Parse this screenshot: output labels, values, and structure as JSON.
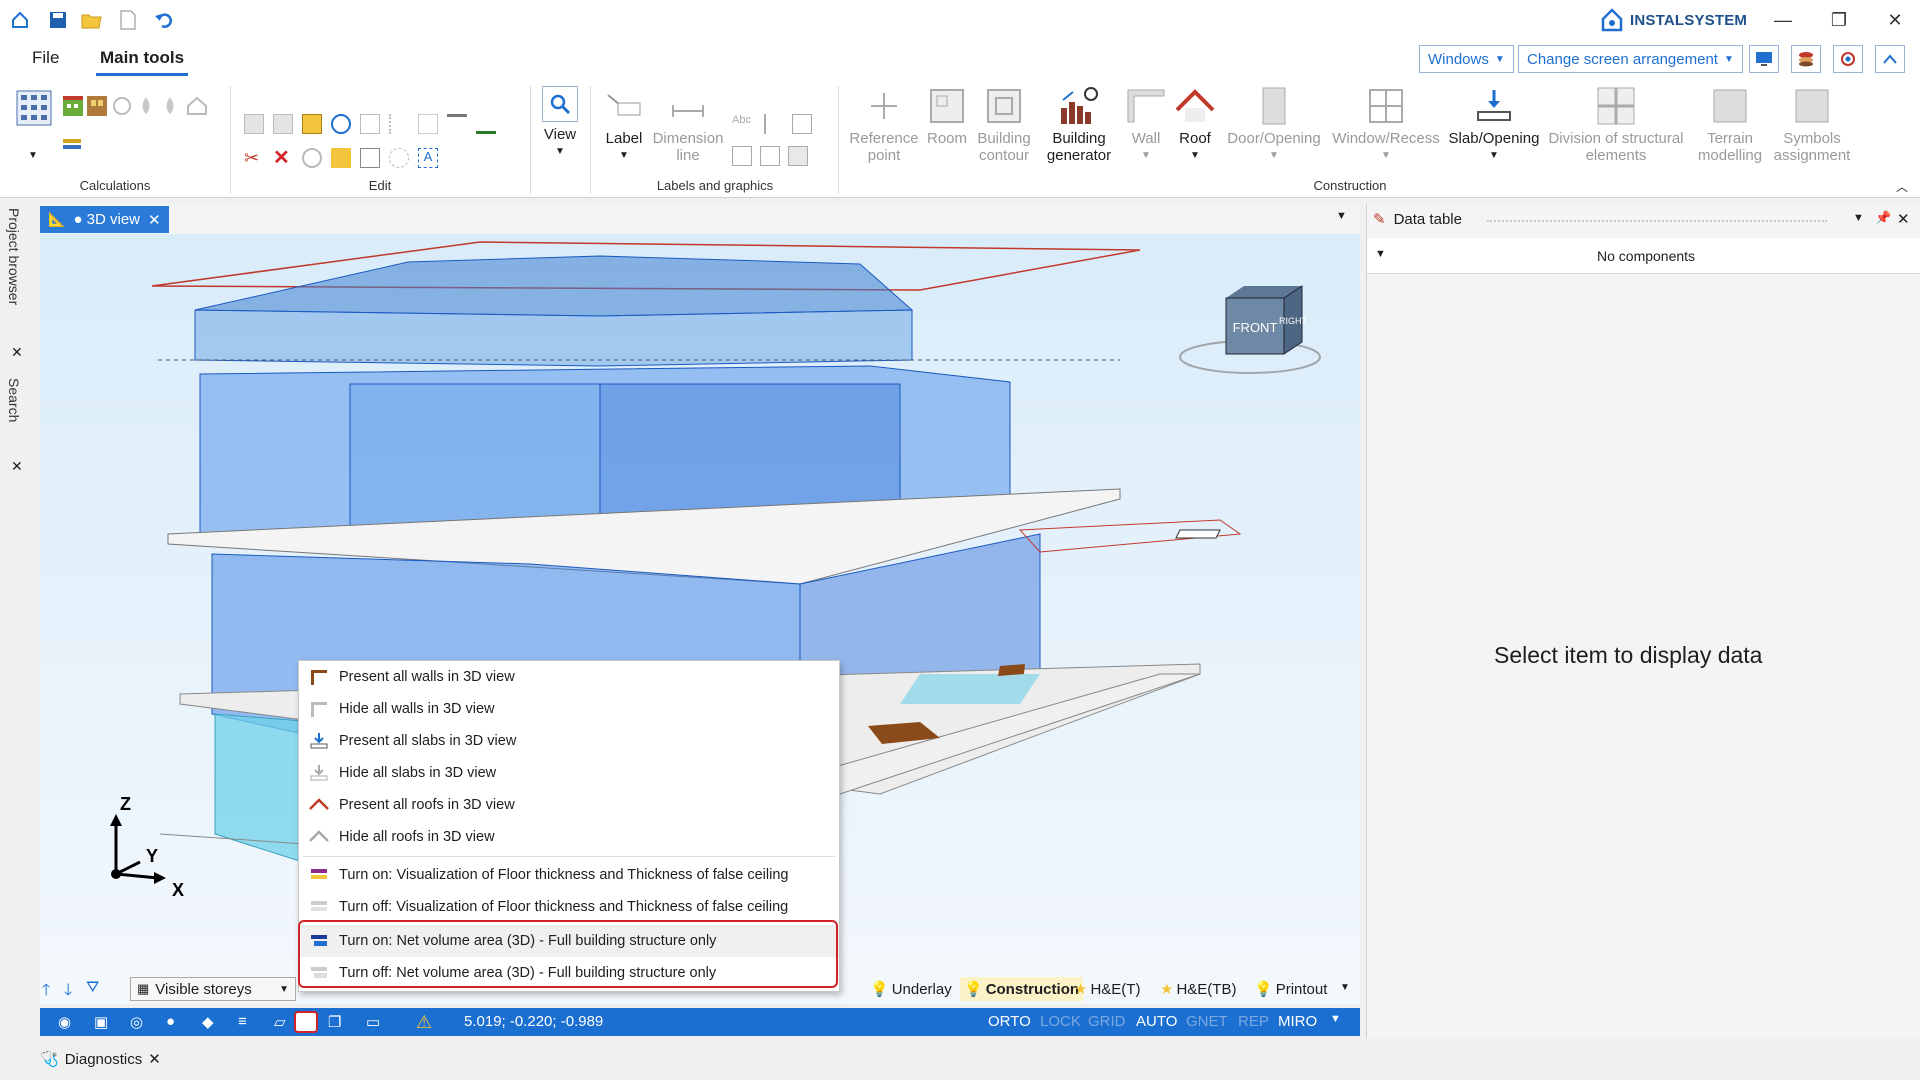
{
  "app": {
    "brand": "INSTALSYSTEM",
    "window_controls": [
      "minimize",
      "restore",
      "close"
    ]
  },
  "menu": {
    "tabs": [
      "File",
      "Main tools"
    ],
    "active_tab": "Main tools",
    "windows_label": "Windows",
    "arrangement_label": "Change screen arrangement"
  },
  "ribbon": {
    "groups": {
      "calculations": "Calculations",
      "edit": "Edit",
      "labels": "Labels and graphics",
      "construction": "Construction"
    },
    "view": "View",
    "label": "Label",
    "dimension_line_1": "Dimension",
    "dimension_line_2": "line",
    "reference_point_1": "Reference",
    "reference_point_2": "point",
    "room": "Room",
    "building_contour_1": "Building",
    "building_contour_2": "contour",
    "building_generator_1": "Building",
    "building_generator_2": "generator",
    "wall": "Wall",
    "roof": "Roof",
    "door_opening": "Door/Opening",
    "window_recess": "Window/Recess",
    "slab_opening": "Slab/Opening",
    "division_1": "Division of structural",
    "division_2": "elements",
    "terrain_1": "Terrain",
    "terrain_2": "modelling",
    "symbols_1": "Symbols",
    "symbols_2": "assignment"
  },
  "left_panels": {
    "project_browser": "Project browser",
    "search": "Search"
  },
  "view_tab": {
    "label": "● 3D view"
  },
  "viewcube": {
    "front": "FRONT",
    "right": "RIGHT"
  },
  "axes": {
    "z": "Z",
    "y": "Y",
    "x": "X"
  },
  "context_menu": {
    "items": [
      "Present all walls in 3D view",
      "Hide all walls in 3D view",
      "Present all slabs in 3D view",
      "Hide all slabs in 3D view",
      "Present all roofs in 3D view",
      "Hide all roofs in 3D view",
      "Turn on: Visualization of Floor thickness and Thickness of false ceiling",
      "Turn off: Visualization of Floor thickness and Thickness of false ceiling",
      "Turn on: Net volume area (3D) - Full building structure only",
      "Turn off: Net volume area (3D) - Full building structure only"
    ]
  },
  "bottom": {
    "visible_storeys": "Visible storeys",
    "layers": [
      "Underlay",
      "Construction",
      "H&E(T)",
      "H&E(TB)",
      "Printout"
    ],
    "active_layer": "Construction"
  },
  "status": {
    "coords": "5.019; -0.220; -0.989",
    "toggles": [
      "ORTO",
      "LOCK",
      "GRID",
      "AUTO",
      "GNET",
      "REP",
      "MIRO"
    ],
    "active_toggles": [
      "ORTO",
      "AUTO",
      "MIRO"
    ]
  },
  "data_table": {
    "title": "Data table",
    "no_components": "No components",
    "placeholder": "Select item to display data"
  },
  "diagnostics": {
    "label": "Diagnostics"
  },
  "colors": {
    "accent": "#1f6fd1",
    "status_bar": "#1b6fd1",
    "highlight": "#d1222a",
    "viewport_bg": "#e6f2fb"
  }
}
